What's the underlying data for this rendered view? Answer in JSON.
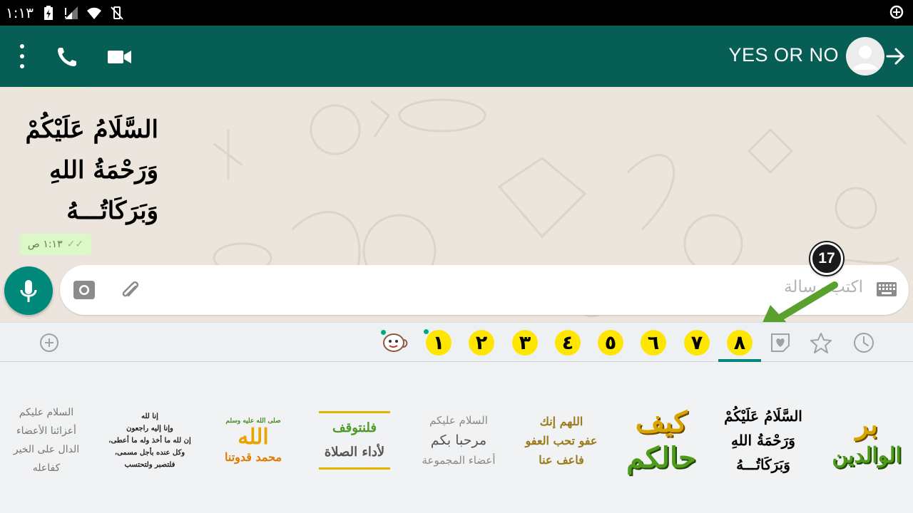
{
  "status_bar": {
    "time": "١:١٣"
  },
  "header": {
    "contact_name": "YES OR NO"
  },
  "chat": {
    "sticker_lines": [
      "السَّلَامُ عَلَيْكُمْ",
      "وَرَحْمَةُ اللهِ",
      "وَبَرَكَاتُـــهُ"
    ],
    "time": "١:١٣ ص"
  },
  "composer": {
    "placeholder": "اكتب رسالة"
  },
  "annotation": {
    "step": "17"
  },
  "sticker_tabs": {
    "numbers": [
      "١",
      "٢",
      "٣",
      "٤",
      "٥",
      "٦",
      "٧",
      "٨"
    ],
    "selected_index": 7
  },
  "stickers": [
    {
      "lines": [
        "السلام عليكم",
        "أعزائنا الأعضاء",
        "الدال على الخير كفاعله"
      ]
    },
    {
      "lines": [
        "إنا لله",
        "وإنا إليه راجعون",
        "إن لله ما أخذ وله ما أعطى،",
        "وكل عنده بأجل مسمى،",
        "فلتصبر ولتحتسب"
      ]
    },
    {
      "lines": [
        "صلى الله عليه وسلم",
        "الله",
        "محمد قدوتنا"
      ]
    },
    {
      "lines": [
        "فلنتوقف",
        "لأداء الصلاة"
      ]
    },
    {
      "lines": [
        "السلام عليكم",
        "مرحبا بكم",
        "أعضاء المجموعة"
      ]
    },
    {
      "lines": [
        "اللهم إنك",
        "عفو تحب العفو",
        "فاعف عنا"
      ]
    },
    {
      "lines": [
        "كيف",
        "حالكم"
      ]
    },
    {
      "lines": [
        "السَّلَامُ عَلَيْكُمْ",
        "وَرَحْمَةُ اللهِ",
        "وَبَرَكَاتُـــهُ"
      ]
    },
    {
      "lines": [
        "بر",
        "الوالدين"
      ]
    }
  ],
  "colors": {
    "header": "#075e54",
    "accent": "#00897b",
    "number_tab": "#ffe600",
    "annotation_arrow": "#5aa02c",
    "bubble": "#dcf8c6"
  }
}
